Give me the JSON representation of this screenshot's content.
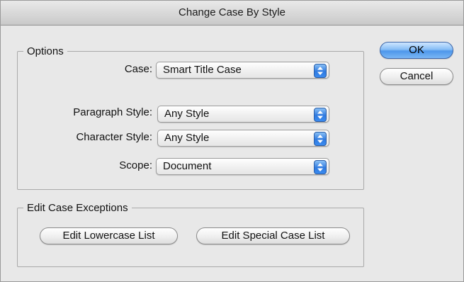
{
  "window": {
    "title": "Change Case By Style"
  },
  "options": {
    "legend": "Options",
    "case": {
      "label": "Case:",
      "value": "Smart Title Case"
    },
    "paragraph_style": {
      "label": "Paragraph Style:",
      "value": "Any Style"
    },
    "character_style": {
      "label": "Character Style:",
      "value": "Any Style"
    },
    "scope": {
      "label": "Scope:",
      "value": "Document"
    }
  },
  "exceptions": {
    "legend": "Edit Case Exceptions",
    "lowercase_button": "Edit Lowercase List",
    "special_button": "Edit Special Case List"
  },
  "buttons": {
    "ok": "OK",
    "cancel": "Cancel"
  },
  "colors": {
    "accent": "#4e97ea",
    "window_bg": "#e8e8e8"
  },
  "icons": {
    "popup_stepper": "up-down-arrows-icon"
  }
}
